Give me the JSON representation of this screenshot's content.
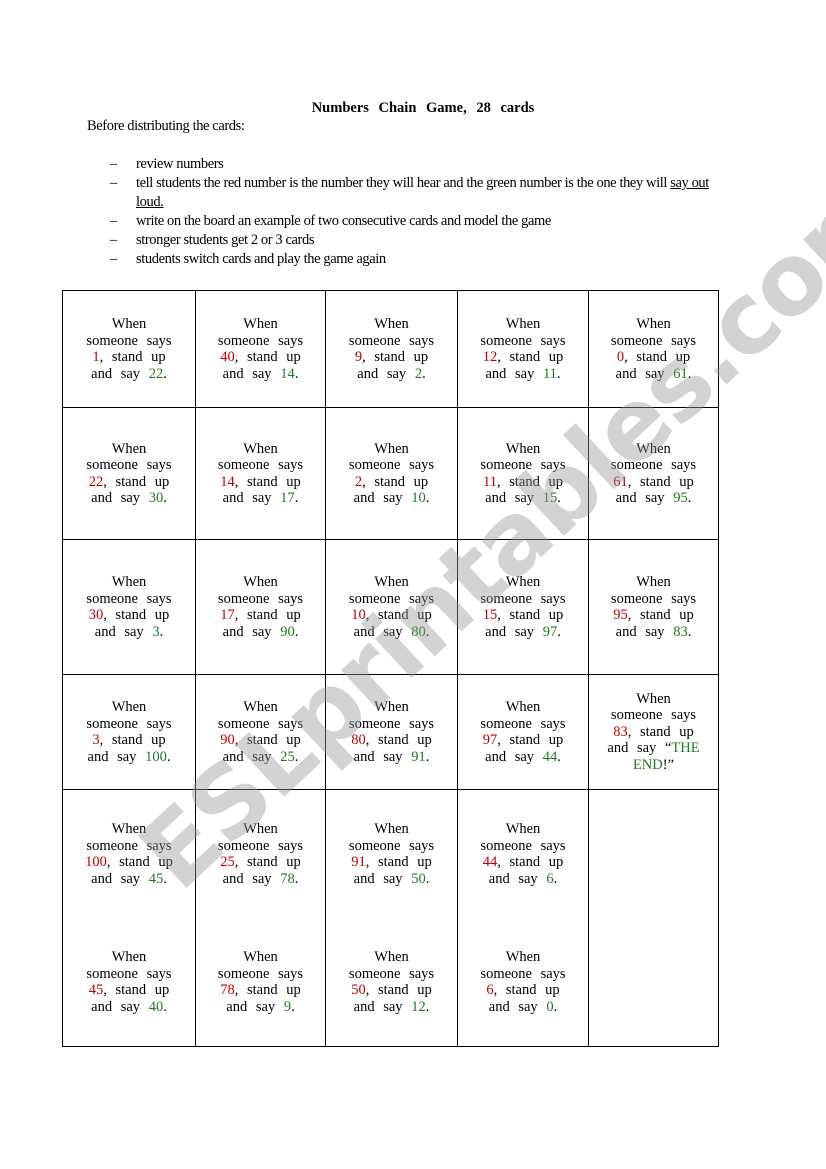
{
  "document": {
    "title": "Numbers  Chain  Game,  28  cards",
    "intro": "Before distributing the cards:",
    "steps": [
      {
        "dash": "–",
        "text": "review numbers"
      },
      {
        "dash": "–",
        "text": "tell students the red number is the number they will hear and the green number is the one they will ",
        "underlined": "say out loud."
      },
      {
        "dash": "–",
        "text": "write on the board an example of two consecutive cards and model the game"
      },
      {
        "dash": "–",
        "text": "stronger students get 2 or 3 cards"
      },
      {
        "dash": "–",
        "text": "students switch cards and play the game again"
      }
    ]
  },
  "card_text": {
    "when": "When",
    "someone_says": "someone  says",
    "stand_up": ", stand up",
    "and_say": "and  say",
    "period": ".",
    "end_open": "“",
    "end_close": "!”"
  },
  "cards": [
    {
      "hear": "1",
      "say": "22"
    },
    {
      "hear": "40",
      "say": "14"
    },
    {
      "hear": "9",
      "say": "2"
    },
    {
      "hear": "12",
      "say": "11"
    },
    {
      "hear": "0",
      "say": "61"
    },
    {
      "hear": "22",
      "say": "30"
    },
    {
      "hear": "14",
      "say": "17"
    },
    {
      "hear": "2",
      "say": "10"
    },
    {
      "hear": "11",
      "say": "15"
    },
    {
      "hear": "61",
      "say": "95"
    },
    {
      "hear": "30",
      "say": "3"
    },
    {
      "hear": "17",
      "say": "90"
    },
    {
      "hear": "10",
      "say": "80"
    },
    {
      "hear": "15",
      "say": "97"
    },
    {
      "hear": "95",
      "say": "83"
    },
    {
      "hear": "3",
      "say": "100"
    },
    {
      "hear": "90",
      "say": "25"
    },
    {
      "hear": "80",
      "say": "91"
    },
    {
      "hear": "97",
      "say": "44"
    },
    {
      "hear": "83",
      "say": "THE END"
    },
    {
      "hear": "100",
      "say": "45"
    },
    {
      "hear": "25",
      "say": "78"
    },
    {
      "hear": "91",
      "say": "50"
    },
    {
      "hear": "44",
      "say": "6"
    },
    {
      "hear": "45",
      "say": "40"
    },
    {
      "hear": "78",
      "say": "9"
    },
    {
      "hear": "50",
      "say": "12"
    },
    {
      "hear": "6",
      "say": "0"
    }
  ],
  "colors": {
    "hear": "#c00000",
    "say": "#1e7a1e"
  },
  "watermark": "ESLprintables.com"
}
